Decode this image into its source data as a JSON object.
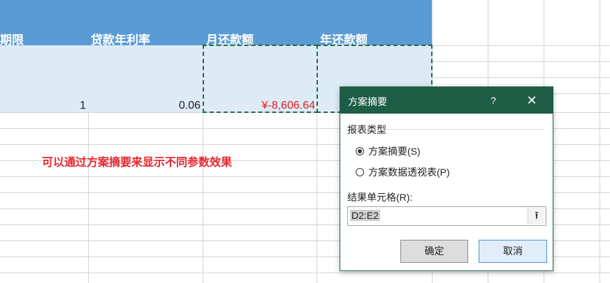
{
  "sheet": {
    "headers": {
      "col_a": "期限",
      "col_b": "贷款年利率",
      "col_c": "月还款额",
      "col_d": "年还款额"
    },
    "row2": {
      "a": "1",
      "b": "0.06",
      "c": "¥-8,606.64"
    },
    "note": "可以通过方案摘要来显示不同参数效果",
    "colors": {
      "header": "#5b9bd5",
      "data_band": "#ddebf7",
      "marquee": "#1e6b3a",
      "note": "#e8262e"
    }
  },
  "dialog": {
    "title": "方案摘要",
    "help_glyph": "?",
    "close_glyph": "✕",
    "report_type_label": "报表类型",
    "options": [
      {
        "label": "方案摘要(S)",
        "selected": true
      },
      {
        "label": "方案数据透视表(P)",
        "selected": false
      }
    ],
    "result_cells_label": "结果单元格(R):",
    "result_cells_value": "D2:E2",
    "collapse_icon": "collapse-icon",
    "ok_label": "确定",
    "cancel_label": "取消",
    "colors": {
      "titlebar": "#1e5e46"
    }
  }
}
